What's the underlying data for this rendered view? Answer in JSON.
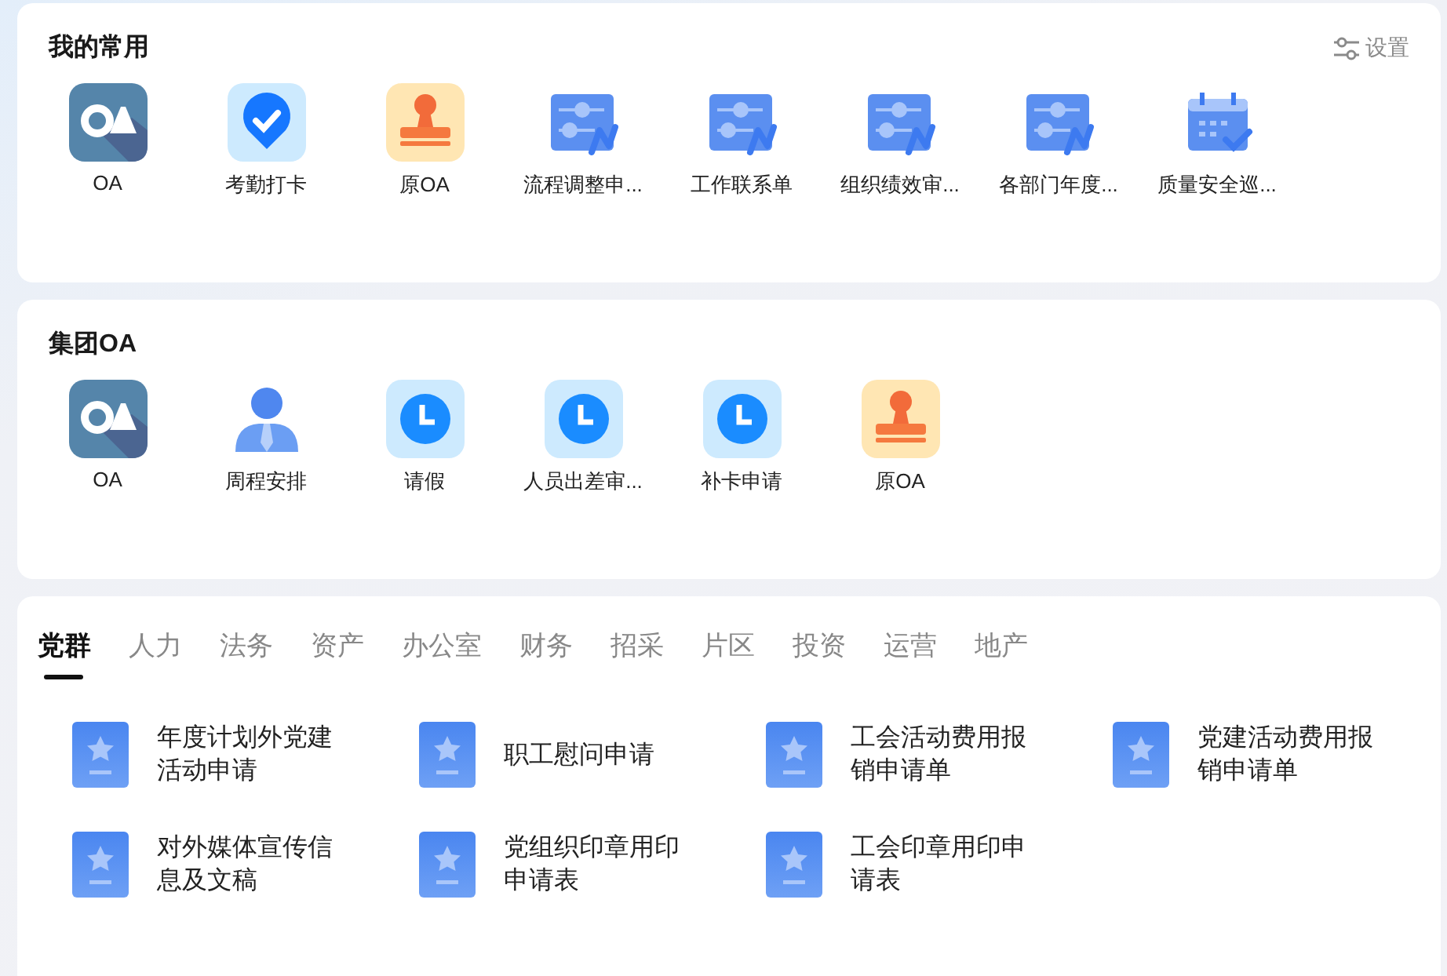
{
  "favorites": {
    "title": "我的常用",
    "settings": "设置",
    "apps": [
      {
        "label": "OA",
        "kind": "oa"
      },
      {
        "label": "考勤打卡",
        "kind": "checkin"
      },
      {
        "label": "原OA",
        "kind": "stamp"
      },
      {
        "label": "流程调整申...",
        "kind": "flow"
      },
      {
        "label": "工作联系单",
        "kind": "flow"
      },
      {
        "label": "组织绩效审...",
        "kind": "flow"
      },
      {
        "label": "各部门年度...",
        "kind": "flow"
      },
      {
        "label": "质量安全巡...",
        "kind": "calendar"
      }
    ]
  },
  "group_oa": {
    "title": "集团OA",
    "apps": [
      {
        "label": "OA",
        "kind": "oa"
      },
      {
        "label": "周程安排",
        "kind": "person"
      },
      {
        "label": "请假",
        "kind": "clock"
      },
      {
        "label": "人员出差审...",
        "kind": "clock"
      },
      {
        "label": "补卡申请",
        "kind": "clock"
      },
      {
        "label": "原OA",
        "kind": "stamp"
      }
    ]
  },
  "tabs": [
    {
      "label": "党群",
      "selected": true
    },
    {
      "label": "人力",
      "selected": false
    },
    {
      "label": "法务",
      "selected": false
    },
    {
      "label": "资产",
      "selected": false
    },
    {
      "label": "办公室",
      "selected": false
    },
    {
      "label": "财务",
      "selected": false
    },
    {
      "label": "招采",
      "selected": false
    },
    {
      "label": "片区",
      "selected": false
    },
    {
      "label": "投资",
      "selected": false
    },
    {
      "label": "运营",
      "selected": false
    },
    {
      "label": "地产",
      "selected": false
    }
  ],
  "forms": [
    {
      "label": "年度计划外党建活动申请"
    },
    {
      "label": "职工慰问申请"
    },
    {
      "label": "工会活动费用报销申请单"
    },
    {
      "label": "党建活动费用报销申请单"
    },
    {
      "label": "对外媒体宣传信息及文稿"
    },
    {
      "label": "党组织印章用印申请表"
    },
    {
      "label": "工会印章用印申请表"
    }
  ]
}
